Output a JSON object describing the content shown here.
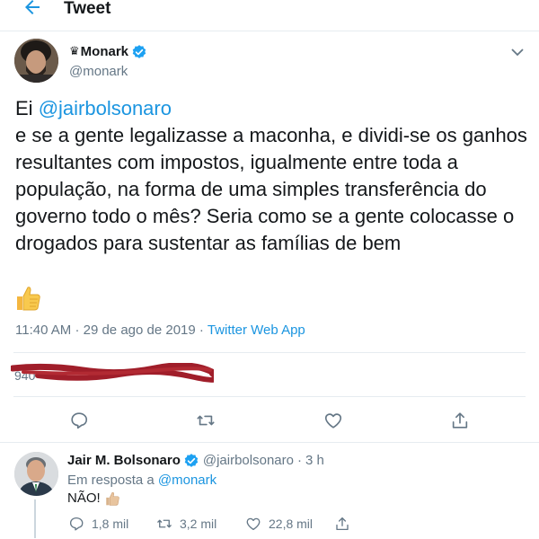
{
  "header": {
    "title": "Tweet",
    "back_icon": "arrow-left-icon"
  },
  "tweet": {
    "crown": "♛",
    "display_name": "Monark",
    "handle": "@monark",
    "text_prefix": "Ei ",
    "mention": "@jairbolsonaro",
    "text_body": "\n e se a gente legalizasse a maconha, e dividi-se os ganhos resultantes com impostos, igualmente entre toda a população, na forma de uma simples transferência do governo todo o mês? Seria como se a gente colocasse o drogados para sustentar as famílias de bem",
    "time": "11:40 AM",
    "separator": "·",
    "date": "29 de ago de 2019",
    "app": "Twitter Web App",
    "stats_redacted": true
  },
  "reply": {
    "display_name": "Jair M. Bolsonaro",
    "handle": "@jairbolsonaro",
    "age": "3 h",
    "separator": "·",
    "in_reply_prefix": "Em resposta a ",
    "in_reply_to": "@monark",
    "text": "NÃO!",
    "replies": "1,8 mil",
    "retweets": "3,2 mil",
    "likes": "22,8 mil"
  },
  "colors": {
    "accent": "#1b95e0",
    "muted": "#657786",
    "divider": "#e6ecf0",
    "redaction": "#a01e2a"
  }
}
